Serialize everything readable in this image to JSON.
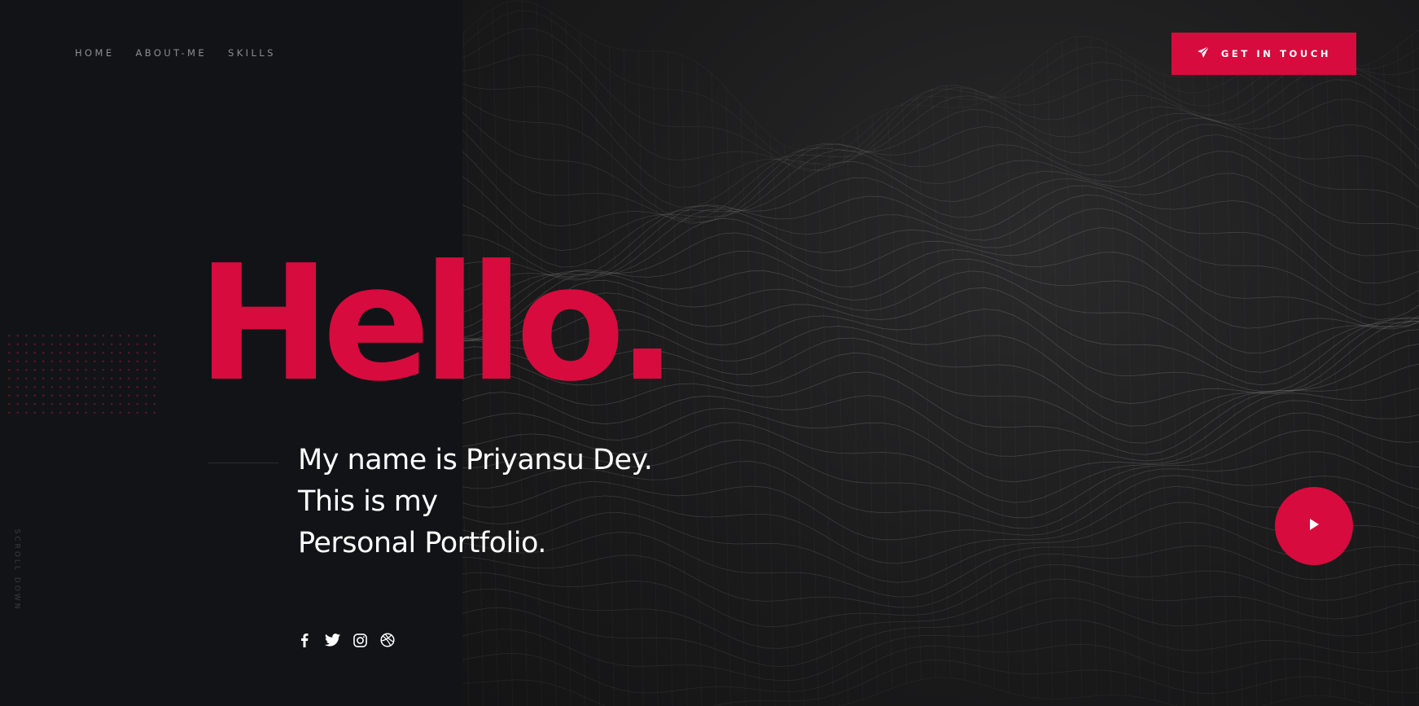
{
  "nav": {
    "items": [
      {
        "label": "HOME"
      },
      {
        "label": "ABOUT-ME"
      },
      {
        "label": "SKILLS"
      }
    ]
  },
  "cta": {
    "label": "GET IN TOUCH",
    "icon": "paper-plane-icon"
  },
  "hero": {
    "headline": "Hello.",
    "intro_lines": [
      "My name is Priyansu Dey.",
      "This is my",
      "Personal Portfolio."
    ]
  },
  "social": {
    "icons": [
      "facebook-icon",
      "twitter-icon",
      "instagram-icon",
      "dribbble-icon"
    ]
  },
  "scroll_hint": {
    "label": "SCROLL DOWN"
  },
  "play_button": {
    "icon": "play-icon"
  },
  "colors": {
    "accent": "#d70b3d",
    "background": "#121317",
    "nav_text": "#8c8e94",
    "text": "#ffffff"
  }
}
